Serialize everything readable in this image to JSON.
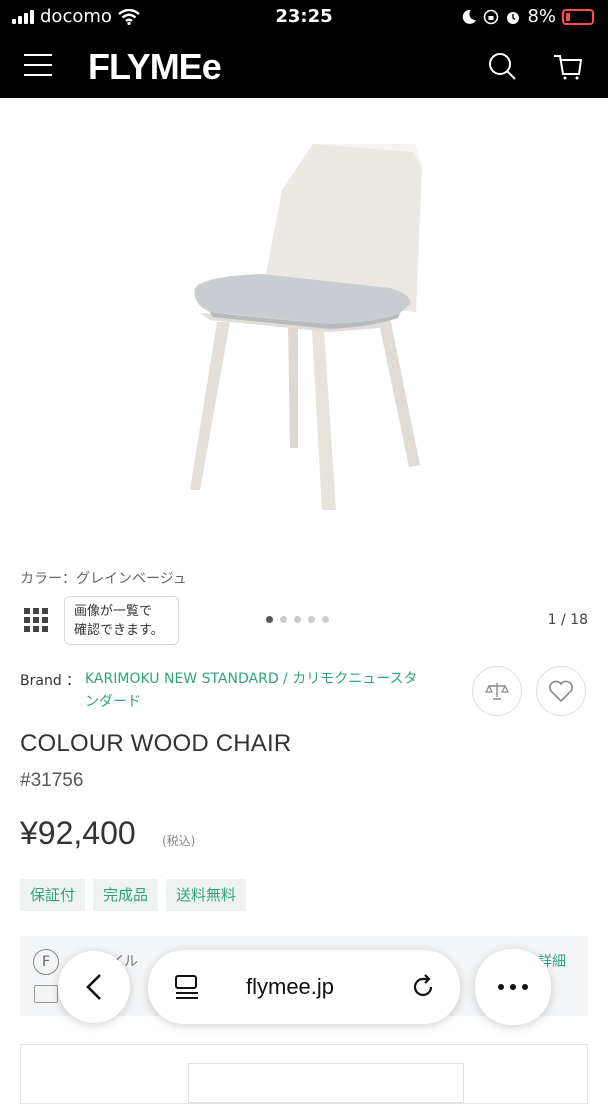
{
  "status_bar": {
    "carrier": "docomo",
    "time": "23:25",
    "battery": "8%"
  },
  "nav": {
    "logo": "FLYMEe"
  },
  "product": {
    "color_label": "カラー：グレインベージュ",
    "gallery_hint": "画像が一覧で\n確認できます。",
    "image_counter": "1 / 18",
    "brand_label": "Brand ：",
    "brand_name": "KARIMOKU NEW STANDARD / カリモクニュースタンダード",
    "title": "COLOUR WOOD CHAIR",
    "sku": "#31756",
    "price": "¥92,400",
    "tax_note": "(税込)",
    "tags": [
      "保証付",
      "完成品",
      "送料無料"
    ]
  },
  "info_panel": {
    "text_partial": "イル",
    "link_partial": "詳細"
  },
  "safari": {
    "url": "flymee.jp"
  },
  "colors": {
    "accent": "#2fa57f",
    "header": "#000000"
  },
  "icons": [
    "wifi-icon",
    "moon-icon",
    "alarm-icon",
    "menu-icon",
    "search-icon",
    "cart-icon",
    "gallery-grid-icon",
    "compare-icon",
    "heart-icon",
    "back-icon",
    "tabs-icon",
    "reload-icon",
    "more-icon"
  ]
}
